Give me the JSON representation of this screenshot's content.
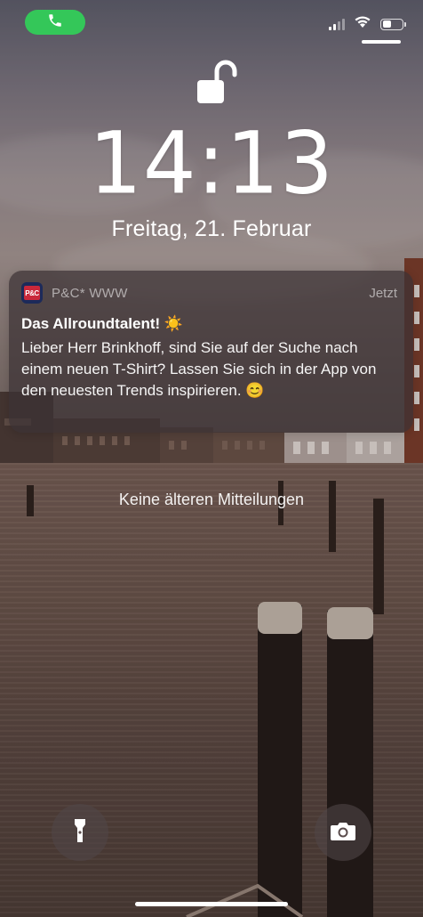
{
  "status_bar": {
    "call_icon": "phone-icon",
    "signal_icon": "cellular-signal-icon",
    "wifi_icon": "wifi-icon",
    "battery_icon": "battery-icon",
    "battery_level": 0.45
  },
  "lock_icon": "unlocked-padlock-icon",
  "clock": {
    "time": "14:13",
    "date": "Freitag, 21. Februar"
  },
  "notification": {
    "app_icon": "app-logo-icon",
    "app_icon_text": "P&C",
    "app_name": "P&C* WWW",
    "time": "Jetzt",
    "title": "Das Allroundtalent! ☀️",
    "body": "Lieber Herr Brinkhoff, sind Sie auf der Suche nach einem neuen T-Shirt? Lassen Sie sich in der App von den neuesten Trends inspirieren. 😊"
  },
  "no_older_notifications": "Keine älteren Mitteilungen",
  "bottom": {
    "flashlight_icon": "flashlight-icon",
    "camera_icon": "camera-icon"
  },
  "colors": {
    "call_pill": "#34c759",
    "notification_bg": "#3c3234",
    "app_icon_bg": "#1c2a5a",
    "app_icon_red": "#c9283b"
  }
}
